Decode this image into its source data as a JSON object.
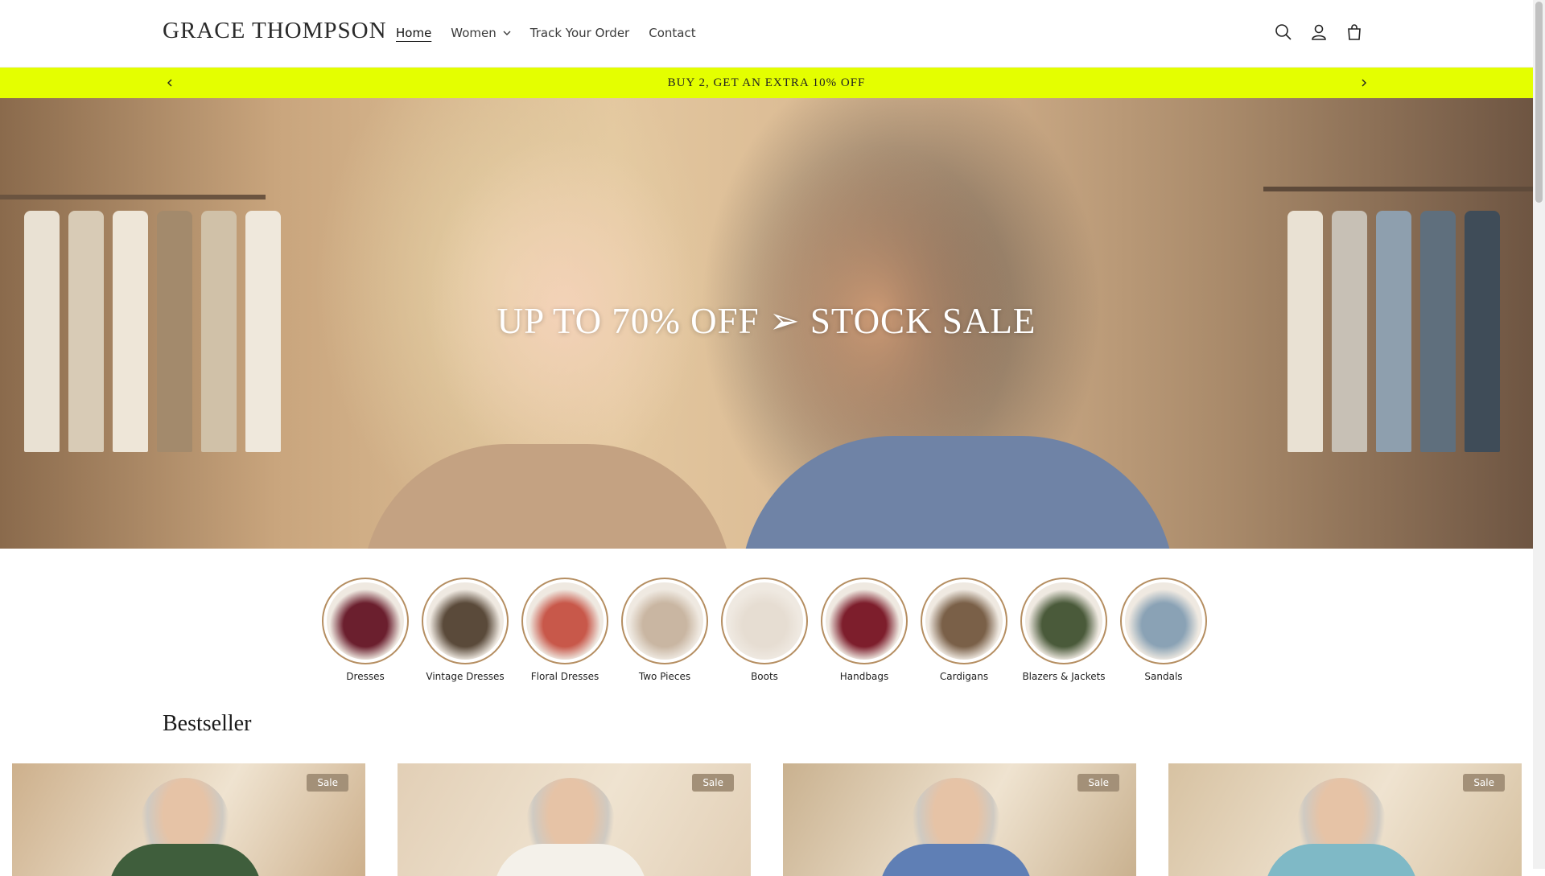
{
  "header": {
    "logo": "GRACE THOMPSON",
    "nav": [
      {
        "label": "Home",
        "active": true
      },
      {
        "label": "Women",
        "has_dropdown": true
      },
      {
        "label": "Track Your Order"
      },
      {
        "label": "Contact"
      }
    ],
    "icons": [
      "search-icon",
      "account-icon",
      "cart-icon"
    ]
  },
  "announcement": {
    "text": "BUY 2, GET AN EXTRA 10% OFF",
    "prev_icon": "chevron-left-icon",
    "next_icon": "chevron-right-icon",
    "bg_color": "#e4ff00"
  },
  "hero": {
    "title": "UP TO 70% OFF ➢ STOCK SALE"
  },
  "categories": [
    {
      "label": "Dresses",
      "color": "#6b1f2e"
    },
    {
      "label": "Vintage Dresses",
      "color": "#5a4a3a"
    },
    {
      "label": "Floral Dresses",
      "color": "#c8584a"
    },
    {
      "label": "Two Pieces",
      "color": "#c9b6a2"
    },
    {
      "label": "Boots",
      "color": "#e6ddd2"
    },
    {
      "label": "Handbags",
      "color": "#7d1e2c"
    },
    {
      "label": "Cardigans",
      "color": "#7a6048"
    },
    {
      "label": "Blazers & Jackets",
      "color": "#4a5a3a"
    },
    {
      "label": "Sandals",
      "color": "#8aa2b5"
    }
  ],
  "bestseller": {
    "title": "Bestseller",
    "products": [
      {
        "badge": "Sale",
        "bg": "#cdb08c",
        "top_color": "#3f5e3c"
      },
      {
        "badge": "Sale",
        "bg": "#e2cfb6",
        "top_color": "#f4f1ea"
      },
      {
        "badge": "Sale",
        "bg": "#c9b18f",
        "top_color": "#5f7fb5"
      },
      {
        "badge": "Sale",
        "bg": "#d7c2a2",
        "top_color": "#7fb9c6"
      }
    ]
  }
}
